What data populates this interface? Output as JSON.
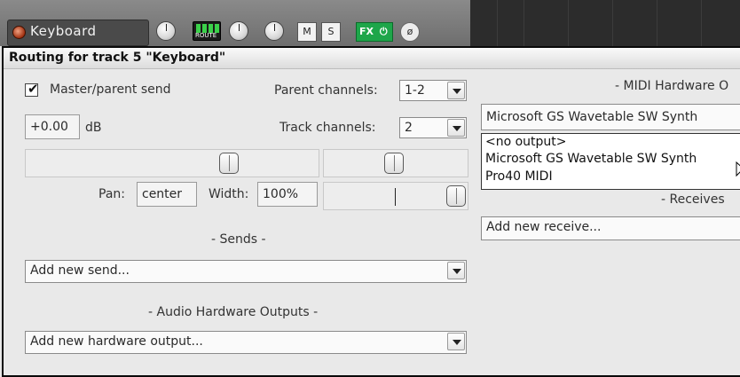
{
  "track": {
    "name": "Keyboard",
    "route_label": "ROUTE",
    "mute_label": "M",
    "solo_label": "S",
    "fx_label": "FX",
    "fx_power_glyph": "⏻",
    "phase_glyph": "ø"
  },
  "dialog": {
    "title": "Routing for track 5 \"Keyboard\"",
    "master_send": {
      "label": "Master/parent send",
      "checked": true
    },
    "parent_channels": {
      "label": "Parent channels:",
      "value": "1-2"
    },
    "volume": {
      "value": "+0.00",
      "unit": "dB"
    },
    "track_channels": {
      "label": "Track channels:",
      "value": "2"
    },
    "pan": {
      "label": "Pan:",
      "value": "center"
    },
    "width": {
      "label": "Width:",
      "value": "100%"
    },
    "sends": {
      "heading": "- Sends -",
      "dropdown_value": "Add new send..."
    },
    "audio_hw_outputs": {
      "heading": "- Audio Hardware Outputs -",
      "dropdown_value": "Add new hardware output..."
    },
    "midi_hw_output": {
      "heading": "- MIDI Hardware O",
      "selected_value": "Microsoft GS Wavetable SW Synth",
      "options": [
        "<no output>",
        "Microsoft GS Wavetable SW Synth",
        "Pro40 MIDI"
      ]
    },
    "receives": {
      "heading": "- Receives",
      "dropdown_value": "Add new receive..."
    }
  }
}
